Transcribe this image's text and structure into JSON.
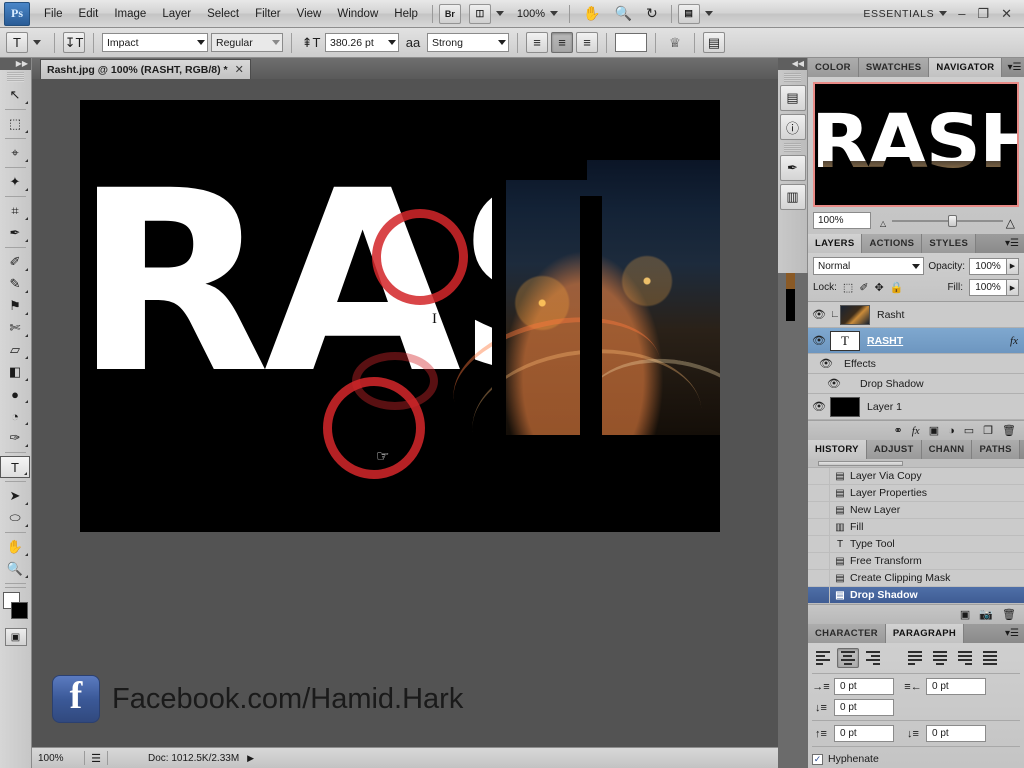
{
  "app": {
    "name": "Adobe Photoshop",
    "logo": "Ps"
  },
  "menubar": {
    "items": [
      "File",
      "Edit",
      "Image",
      "Layer",
      "Select",
      "Filter",
      "View",
      "Window",
      "Help"
    ],
    "bridge_label": "Br",
    "zoom_level": "100%",
    "tools": [
      {
        "name": "hand-tool",
        "glyph": "✋"
      },
      {
        "name": "zoom-tool",
        "glyph": "🔍"
      },
      {
        "name": "rotate-view-tool",
        "glyph": "↻"
      }
    ],
    "workspace": "ESSENTIALS",
    "window_buttons": {
      "minimize": "–",
      "restore": "❐",
      "close": "✕"
    }
  },
  "options_bar": {
    "tool_icon": "T",
    "orientation_label": "↧T",
    "font_family": "Impact",
    "font_style": "Regular",
    "font_size": "380.26 pt",
    "antialias_label": "aa",
    "antialias_method": "Strong",
    "align": [
      "left",
      "center",
      "right"
    ],
    "align_active": 1,
    "color_swatch": "#ffffff",
    "warp_label": "warp-text",
    "panel_toggle_label": "toggle-panels"
  },
  "toolbox": {
    "tools": [
      {
        "name": "move-tool",
        "glyph": "↖",
        "selected": false
      },
      {
        "name": "rectangular-marquee-tool",
        "glyph": "⬚",
        "selected": false
      },
      {
        "name": "lasso-tool",
        "glyph": "⌖",
        "selected": false
      },
      {
        "name": "magic-wand-tool",
        "glyph": "✦",
        "selected": false
      },
      {
        "name": "crop-tool",
        "glyph": "⌗",
        "selected": false
      },
      {
        "name": "eyedropper-tool",
        "glyph": "✒",
        "selected": false
      },
      {
        "name": "spot-healing-brush-tool",
        "glyph": "✐",
        "selected": false
      },
      {
        "name": "brush-tool",
        "glyph": "✎",
        "selected": false
      },
      {
        "name": "clone-stamp-tool",
        "glyph": "⚑",
        "selected": false
      },
      {
        "name": "history-brush-tool",
        "glyph": "✄",
        "selected": false
      },
      {
        "name": "eraser-tool",
        "glyph": "▱",
        "selected": false
      },
      {
        "name": "gradient-tool",
        "glyph": "◧",
        "selected": false
      },
      {
        "name": "blur-tool",
        "glyph": "●",
        "selected": false
      },
      {
        "name": "dodge-tool",
        "glyph": "◔",
        "selected": false
      },
      {
        "name": "pen-tool",
        "glyph": "✑",
        "selected": false
      },
      {
        "name": "horizontal-type-tool",
        "glyph": "T",
        "selected": true
      },
      {
        "name": "path-selection-tool",
        "glyph": "➤",
        "selected": false
      },
      {
        "name": "ellipse-shape-tool",
        "glyph": "⬭",
        "selected": false
      },
      {
        "name": "hand-tool",
        "glyph": "✋",
        "selected": false
      },
      {
        "name": "zoom-tool",
        "glyph": "🔍",
        "selected": false
      }
    ],
    "foreground_color": "#ffffff",
    "background_color": "#000000",
    "quickmask_glyph": "▣"
  },
  "document": {
    "tab_title": "Rasht.jpg @ 100% (RASHT, RGB/8) *",
    "close_glyph": "✕",
    "artwork_text": "RASHT",
    "watermark": {
      "logo_letter": "f",
      "text": "Facebook.com/Hamid.Hark"
    }
  },
  "statusbar": {
    "zoom": "100%",
    "doc_info": "Doc: 1012.5K/2.33M",
    "arrow": "▶"
  },
  "mini_dock": {
    "buttons": [
      {
        "name": "histogram-panel-icon",
        "glyph": "▤"
      },
      {
        "name": "info-panel-icon",
        "glyph": "ⓘ"
      },
      {
        "name": "brush-panel-icon",
        "glyph": "✒"
      },
      {
        "name": "adjustments-panel-icon",
        "glyph": "▥"
      }
    ]
  },
  "navigator_panel": {
    "tabs": [
      "COLOR",
      "SWATCHES",
      "NAVIGATOR"
    ],
    "active_tab": 2,
    "thumb_text": "RASHT",
    "zoom_value": "100%"
  },
  "layers_panel": {
    "tabs": [
      "LAYERS",
      "ACTIONS",
      "STYLES"
    ],
    "active_tab": 0,
    "blend_mode": "Normal",
    "opacity_label": "Opacity:",
    "opacity_value": "100%",
    "lock_label": "Lock:",
    "fill_label": "Fill:",
    "fill_value": "100%",
    "lock_icons": [
      {
        "name": "lock-transparent-pixels-icon",
        "glyph": "⬚"
      },
      {
        "name": "lock-image-pixels-icon",
        "glyph": "✐"
      },
      {
        "name": "lock-position-icon",
        "glyph": "✥"
      },
      {
        "name": "lock-all-icon",
        "glyph": "🔒"
      }
    ],
    "layers": [
      {
        "name": "Rasht",
        "type": "photo",
        "clipped": true,
        "active": false,
        "visible": true
      },
      {
        "name": "RASHT",
        "type": "text",
        "clipped": false,
        "active": true,
        "visible": true,
        "has_fx": true
      },
      {
        "name": "Effects",
        "type": "effects-group",
        "visible": true
      },
      {
        "name": "Drop Shadow",
        "type": "effect",
        "visible": true
      },
      {
        "name": "Layer 1",
        "type": "solid",
        "clipped": false,
        "active": false,
        "visible": true
      }
    ],
    "footer_buttons": [
      {
        "name": "link-layers-button",
        "glyph": "⚭"
      },
      {
        "name": "add-layer-style-button",
        "glyph": "fx"
      },
      {
        "name": "add-layer-mask-button",
        "glyph": "▣"
      },
      {
        "name": "new-fill-adjustment-button",
        "glyph": "◑"
      },
      {
        "name": "new-group-button",
        "glyph": "▭"
      },
      {
        "name": "new-layer-button",
        "glyph": "❐"
      },
      {
        "name": "delete-layer-button",
        "glyph": "🗑"
      }
    ]
  },
  "history_panel": {
    "tabs": [
      "HISTORY",
      "ADJUST",
      "CHANN",
      "PATHS"
    ],
    "active_tab": 0,
    "states": [
      {
        "label": "Layer Via Copy",
        "icon": "▤",
        "active": false
      },
      {
        "label": "Layer Properties",
        "icon": "▤",
        "active": false
      },
      {
        "label": "New Layer",
        "icon": "▤",
        "active": false
      },
      {
        "label": "Fill",
        "icon": "▥",
        "active": false
      },
      {
        "label": "Type Tool",
        "icon": "T",
        "active": false
      },
      {
        "label": "Free Transform",
        "icon": "▤",
        "active": false
      },
      {
        "label": "Create Clipping Mask",
        "icon": "▤",
        "active": false
      },
      {
        "label": "Drop Shadow",
        "icon": "▤",
        "active": true
      }
    ],
    "footer_buttons": [
      {
        "name": "create-document-from-state-button",
        "glyph": "▣"
      },
      {
        "name": "create-new-snapshot-button",
        "glyph": "📷"
      },
      {
        "name": "delete-state-button",
        "glyph": "🗑"
      }
    ]
  },
  "paragraph_panel": {
    "tabs": [
      "CHARACTER",
      "PARAGRAPH"
    ],
    "active_tab": 1,
    "align_buttons": [
      {
        "name": "align-left-button",
        "active": false
      },
      {
        "name": "align-center-button",
        "active": true
      },
      {
        "name": "align-right-button",
        "active": false
      }
    ],
    "justify_buttons": [
      {
        "name": "justify-last-left-button",
        "active": false
      },
      {
        "name": "justify-last-center-button",
        "active": false
      },
      {
        "name": "justify-last-right-button",
        "active": false
      },
      {
        "name": "justify-all-button",
        "active": false
      }
    ],
    "fields": [
      {
        "name": "indent-left-margin",
        "icon": "→≡",
        "value": "0 pt"
      },
      {
        "name": "indent-right-margin",
        "icon": "≡←",
        "value": "0 pt"
      },
      {
        "name": "indent-first-line",
        "icon": "↓≡",
        "value": "0 pt"
      },
      {
        "name": "space-before-paragraph",
        "icon": "↑≡",
        "value": "0 pt"
      },
      {
        "name": "space-after-paragraph",
        "icon": "↓≡",
        "value": "0 pt"
      }
    ],
    "hyphenate_label": "Hyphenate",
    "hyphenate_checked": true,
    "check_glyph": "✓"
  },
  "colors": {
    "accent_red": "#d3262a",
    "selection_blue": "#6d96c0",
    "history_blue": "#3f5c93",
    "panel_gray": "#c4c4c4"
  }
}
